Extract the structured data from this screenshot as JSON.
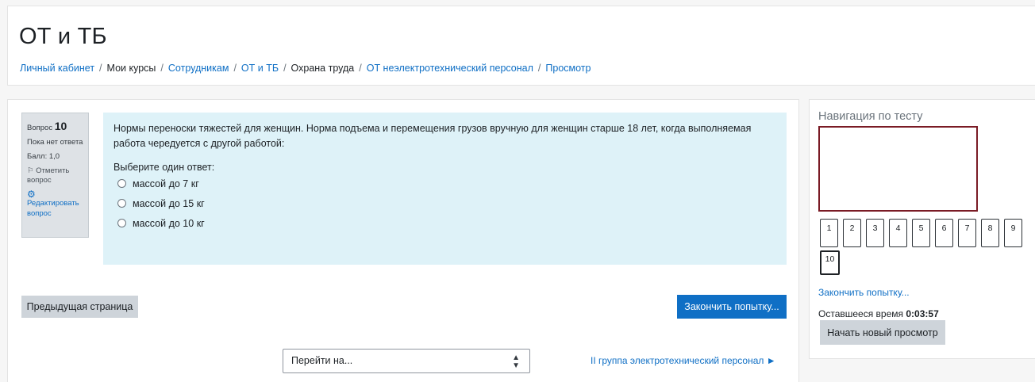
{
  "header": {
    "title": "ОТ и ТБ",
    "breadcrumb": [
      {
        "label": "Личный кабинет",
        "link": true
      },
      {
        "label": "Мои курсы",
        "link": false
      },
      {
        "label": "Сотрудникам",
        "link": true
      },
      {
        "label": "ОТ и ТБ",
        "link": true
      },
      {
        "label": "Охрана труда",
        "link": false
      },
      {
        "label": "ОТ неэлектротехнический персонал",
        "link": true
      },
      {
        "label": "Просмотр",
        "link": true
      }
    ],
    "separator": "/"
  },
  "question_info": {
    "number_label": "Вопрос",
    "number": "10",
    "status": "Пока нет ответа",
    "grade": "Балл: 1,0",
    "flag_icon": "flag-icon",
    "flag_label": "Отметить вопрос",
    "edit_icon": "gear-icon",
    "edit_label": "Редактировать вопрос"
  },
  "question": {
    "text": "Нормы переноски тяжестей для женщин. Норма подъема и перемещения грузов вручную для женщин старше 18 лет, когда выполняемая работа чередуется с другой работой:",
    "prompt": "Выберите один ответ:",
    "answers": [
      "массой до 7 кг",
      "массой до 15 кг",
      "массой до 10 кг"
    ]
  },
  "buttons": {
    "prev": "Предыдущая страница",
    "finish": "Закончить попытку...",
    "new_attempt": "Начать новый просмотр"
  },
  "jump": {
    "placeholder": "Перейти на...",
    "next_link": "II группа электротехнический персонал ►"
  },
  "navigation": {
    "title": "Навигация по тесту",
    "questions": [
      "1",
      "2",
      "3",
      "4",
      "5",
      "6",
      "7",
      "8",
      "9",
      "10"
    ],
    "current": "10",
    "finish_link": "Закончить попытку...",
    "time_label": "Оставшееся время",
    "time_value": "0:03:57"
  },
  "colors": {
    "link": "#0f6fc5",
    "primary_button": "#0f6fc5",
    "question_bg": "#def2f8",
    "user_box_border": "#7a1b25"
  }
}
